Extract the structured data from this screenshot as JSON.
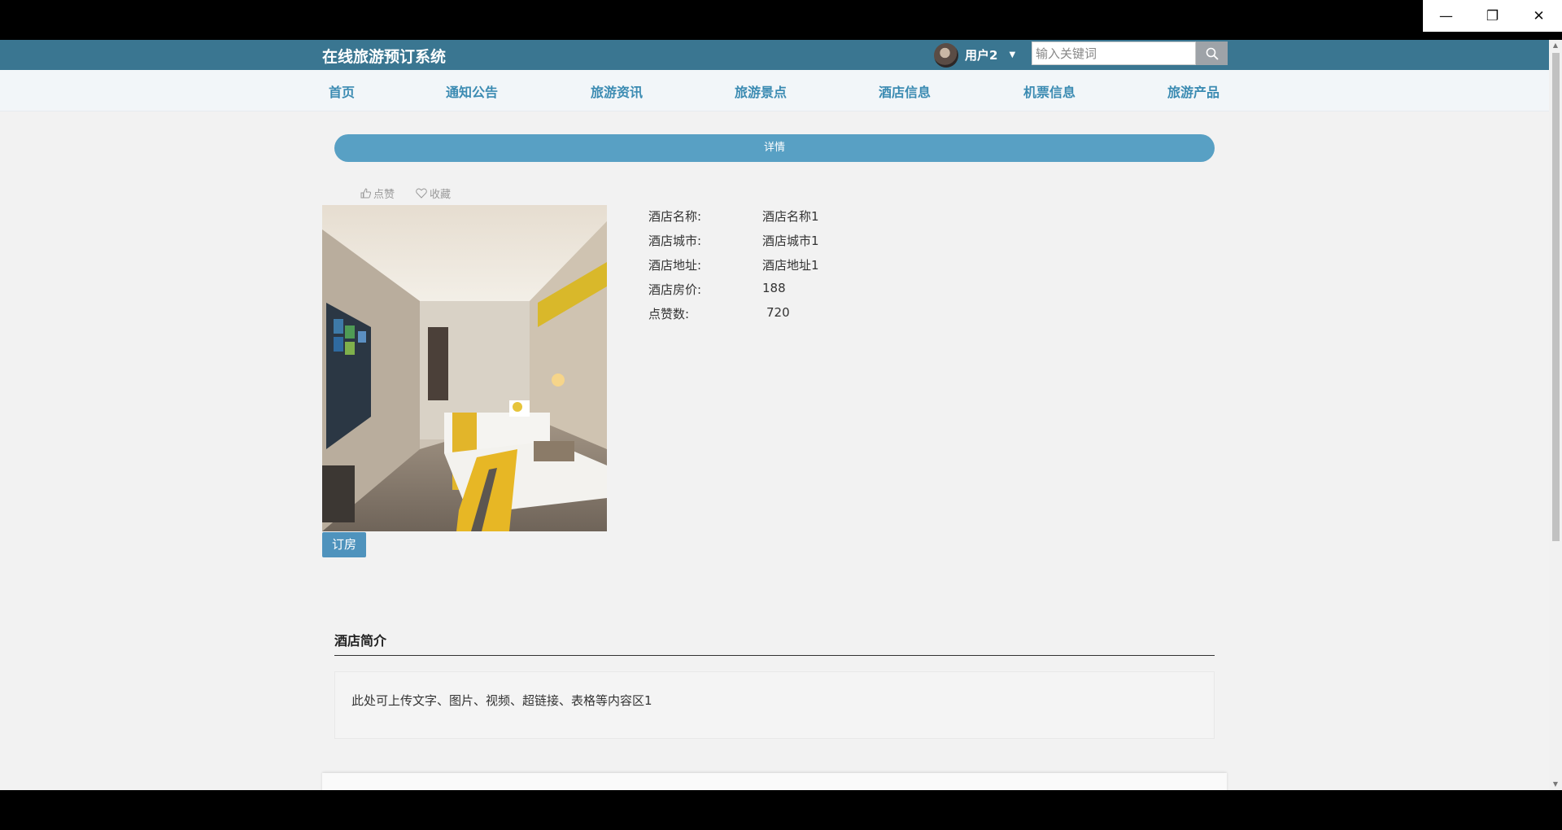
{
  "window": {
    "minimize": "—",
    "restore": "❐",
    "close": "✕"
  },
  "header": {
    "site_title": "在线旅游预订系统",
    "username": "用户2",
    "search_placeholder": "输入关键词"
  },
  "nav": {
    "items": [
      "首页",
      "通知公告",
      "旅游资讯",
      "旅游景点",
      "酒店信息",
      "机票信息",
      "旅游产品"
    ]
  },
  "detail": {
    "section_bar": "详情",
    "like_label": "点赞",
    "favorite_label": "收藏",
    "book_button": "订房",
    "fields": [
      {
        "label": "酒店名称:",
        "value": "酒店名称1"
      },
      {
        "label": "酒店城市:",
        "value": "酒店城市1"
      },
      {
        "label": "酒店地址:",
        "value": "酒店地址1"
      },
      {
        "label": "酒店房价:",
        "value": "188"
      },
      {
        "label": "点赞数:",
        "value": "720"
      }
    ]
  },
  "intro": {
    "title": "酒店简介",
    "text": "此处可上传文字、图片、视频、超链接、表格等内容区1"
  },
  "colors": {
    "header_bg": "#3a7691",
    "nav_text": "#3b8bb2",
    "accent": "#58a0c4",
    "button": "#4f93bd"
  }
}
